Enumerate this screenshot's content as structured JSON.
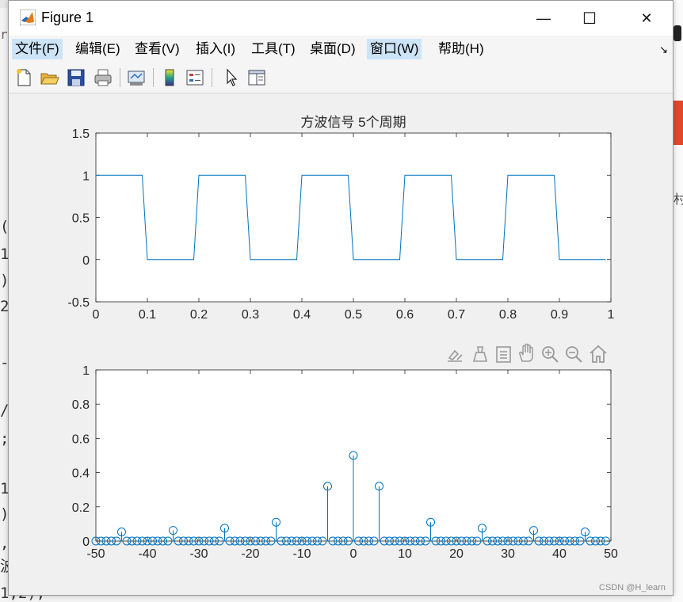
{
  "window": {
    "title": "Figure 1",
    "minimize_glyph": "—",
    "maximize_glyph": "☐",
    "close_glyph": "✕"
  },
  "menu": {
    "items": [
      {
        "label": "文件(F)",
        "active": true
      },
      {
        "label": "编辑(E)",
        "active": false
      },
      {
        "label": "查看(V)",
        "active": false
      },
      {
        "label": "插入(I)",
        "active": false
      },
      {
        "label": "工具(T)",
        "active": false
      },
      {
        "label": "桌面(D)",
        "active": false
      },
      {
        "label": "窗口(W)",
        "active": true
      },
      {
        "label": "帮助(H)",
        "active": false
      }
    ],
    "overflow_glyph": "↘"
  },
  "toolbar": {
    "icons": [
      "new-figure-icon",
      "open-file-icon",
      "save-icon",
      "print-icon",
      "link-plot-icon",
      "colorbar-icon",
      "legend-icon",
      "pointer-icon",
      "property-inspector-icon"
    ]
  },
  "axes_toolbar": {
    "icons": [
      "brush-export-icon",
      "data-brush-icon",
      "data-tips-icon",
      "pan-icon",
      "zoom-in-icon",
      "zoom-out-icon",
      "home-icon"
    ]
  },
  "background": {
    "code_lines": [
      "(",
      "1",
      ")",
      "2",
      "-",
      "/",
      ";",
      "1",
      ")",
      ",",
      "波",
      "1,2);"
    ],
    "right_text": "村",
    "top_text": "re"
  },
  "watermark": "CSDN @H_learn",
  "colors": {
    "series": "#0072bd",
    "axes_bg": "#ffffff",
    "figure_bg": "#f0f0f0"
  },
  "chart_data": [
    {
      "type": "line",
      "title": "方波信号 5个周期",
      "xlabel": "",
      "ylabel": "",
      "xlim": [
        0,
        1
      ],
      "ylim": [
        -0.5,
        1.5
      ],
      "xticks": [
        "0",
        "0.1",
        "0.2",
        "0.3",
        "0.4",
        "0.5",
        "0.6",
        "0.7",
        "0.8",
        "0.9",
        "1"
      ],
      "yticks": [
        "-0.5",
        "0",
        "0.5",
        "1",
        "1.5"
      ],
      "x": [
        0,
        0.09,
        0.1,
        0.19,
        0.2,
        0.29,
        0.3,
        0.39,
        0.4,
        0.49,
        0.5,
        0.59,
        0.6,
        0.69,
        0.7,
        0.79,
        0.8,
        0.89,
        0.9,
        0.99
      ],
      "y": [
        1,
        1,
        0,
        0,
        1,
        1,
        0,
        0,
        1,
        1,
        0,
        0,
        1,
        1,
        0,
        0,
        1,
        1,
        0,
        0
      ]
    },
    {
      "type": "stem",
      "title": "",
      "xlabel": "",
      "ylabel": "",
      "xlim": [
        -50,
        50
      ],
      "ylim": [
        0,
        1
      ],
      "xticks": [
        "-50",
        "-40",
        "-30",
        "-20",
        "-10",
        "0",
        "10",
        "20",
        "30",
        "40",
        "50"
      ],
      "yticks": [
        "0",
        "0.2",
        "0.4",
        "0.6",
        "0.8",
        "1"
      ],
      "n_range": [
        -50,
        49
      ],
      "nonzero": [
        {
          "n": -45,
          "value": 0.053
        },
        {
          "n": -35,
          "value": 0.062
        },
        {
          "n": -25,
          "value": 0.075
        },
        {
          "n": -15,
          "value": 0.11
        },
        {
          "n": -5,
          "value": 0.32
        },
        {
          "n": 0,
          "value": 0.5
        },
        {
          "n": 5,
          "value": 0.32
        },
        {
          "n": 15,
          "value": 0.11
        },
        {
          "n": 25,
          "value": 0.075
        },
        {
          "n": 35,
          "value": 0.062
        },
        {
          "n": 45,
          "value": 0.053
        }
      ]
    }
  ]
}
